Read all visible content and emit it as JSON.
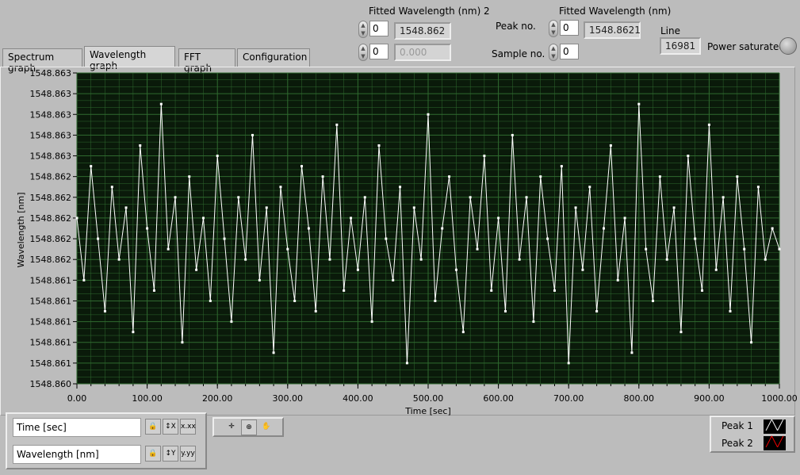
{
  "top": {
    "fitted2_label": "Fitted Wavelength (nm) 2",
    "fitted2_index1": "0",
    "fitted2_value1": "1548.862",
    "fitted2_index2": "0",
    "fitted2_value2": "0.000",
    "peak_label": "Peak no.",
    "peak_value": "0",
    "sample_label": "Sample no.",
    "sample_value": "0",
    "fitted_label": "Fitted Wavelength (nm)",
    "fitted_value": "1548.8621",
    "line_label": "Line",
    "line_value": "16981",
    "power_label": "Power saturated",
    "power_led_color": "#9a9a9a"
  },
  "tabs": [
    {
      "label": "Spectrum graph"
    },
    {
      "label": "Wavelength graph",
      "active": true
    },
    {
      "label": "FFT graph"
    },
    {
      "label": "Configuration"
    }
  ],
  "scale": {
    "x_name": "Time [sec]",
    "y_name": "Wavelength [nm]"
  },
  "legend": [
    {
      "label": "Peak 1",
      "color": "#ffffff"
    },
    {
      "label": "Peak 2",
      "color": "#ff0000"
    }
  ],
  "palette": {
    "icons": [
      "cursor-icon",
      "zoom-icon",
      "pan-icon"
    ]
  },
  "chart_data": {
    "type": "line",
    "xlabel": "Time [sec]",
    "ylabel": "Wavelength [nm]",
    "xlim": [
      0,
      1000
    ],
    "ylim": [
      1548.8604,
      1548.8634
    ],
    "x_ticks": [
      "0.00",
      "100.00",
      "200.00",
      "300.00",
      "400.00",
      "500.00",
      "600.00",
      "700.00",
      "800.00",
      "900.00",
      "1000.00"
    ],
    "y_ticks": [
      "1548.860",
      "1548.861",
      "1548.861",
      "1548.861",
      "1548.861",
      "1548.861",
      "1548.862",
      "1548.862",
      "1548.862",
      "1548.862",
      "1548.862",
      "1548.863",
      "1548.863",
      "1548.863",
      "1548.863",
      "1548.863"
    ],
    "grid": true,
    "background": "#0a1a0a",
    "grid_color": "#2f6a2f",
    "line_color": "#ffffff",
    "series": [
      {
        "name": "Peak 1",
        "x_start": 0,
        "x_step": 10,
        "values": [
          1548.862,
          1548.8614,
          1548.8625,
          1548.8618,
          1548.8611,
          1548.8623,
          1548.8616,
          1548.8621,
          1548.8609,
          1548.8627,
          1548.8619,
          1548.8613,
          1548.8631,
          1548.8617,
          1548.8622,
          1548.8608,
          1548.8624,
          1548.8615,
          1548.862,
          1548.8612,
          1548.8626,
          1548.8618,
          1548.861,
          1548.8622,
          1548.8616,
          1548.8628,
          1548.8614,
          1548.8621,
          1548.8607,
          1548.8623,
          1548.8617,
          1548.8612,
          1548.8625,
          1548.8619,
          1548.8611,
          1548.8624,
          1548.8616,
          1548.8629,
          1548.8613,
          1548.862,
          1548.8615,
          1548.8622,
          1548.861,
          1548.8627,
          1548.8618,
          1548.8614,
          1548.8623,
          1548.8606,
          1548.8621,
          1548.8616,
          1548.863,
          1548.8612,
          1548.8619,
          1548.8624,
          1548.8615,
          1548.8609,
          1548.8622,
          1548.8617,
          1548.8626,
          1548.8613,
          1548.862,
          1548.8611,
          1548.8628,
          1548.8616,
          1548.8622,
          1548.861,
          1548.8624,
          1548.8618,
          1548.8613,
          1548.8625,
          1548.8606,
          1548.8621,
          1548.8615,
          1548.8623,
          1548.8611,
          1548.8619,
          1548.8627,
          1548.8614,
          1548.862,
          1548.8607,
          1548.8631,
          1548.8617,
          1548.8612,
          1548.8624,
          1548.8616,
          1548.8621,
          1548.8609,
          1548.8626,
          1548.8618,
          1548.8613,
          1548.8629,
          1548.8615,
          1548.8622,
          1548.8611,
          1548.8624,
          1548.8617,
          1548.8608,
          1548.8623,
          1548.8616,
          1548.8619,
          1548.8617
        ]
      }
    ]
  }
}
